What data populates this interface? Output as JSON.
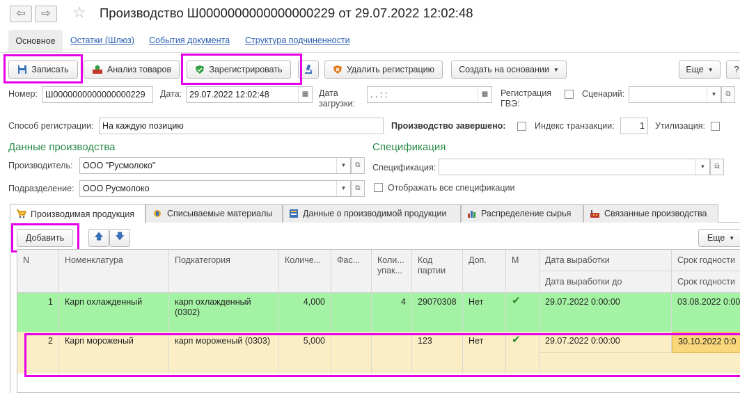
{
  "window": {
    "title": "Производство Ш0000000000000000229 от 29.07.2022 12:02:48",
    "back_icon": "arrow-left-icon",
    "forward_icon": "arrow-right-icon",
    "favorite_icon": "star-icon"
  },
  "tabs": [
    {
      "label": "Основное"
    },
    {
      "label": "Остатки (Шлюз)"
    },
    {
      "label": "События документа"
    },
    {
      "label": "Структура подчиненности"
    }
  ],
  "toolbar": {
    "save_label": "Записать",
    "analyze_label": "Анализ товаров",
    "register_label": "Зарегистрировать",
    "delete_reg_label": "Удалить регистрацию",
    "create_based_label": "Создать на основании",
    "more_label": "Еще",
    "help_label": "?"
  },
  "header": {
    "number_label": "Номер:",
    "number_value": "Ш0000000000000000229",
    "date_label": "Дата:",
    "date_value": "29.07.2022 12:02:48",
    "load_date_label": "Дата загрузки:",
    "load_date_value": " .   .        :   :",
    "gve_label": "Регистрация ГВЭ:",
    "scenario_label": "Сценарий:",
    "scenario_value": "",
    "method_label": "Способ регистрации:",
    "method_value": "На каждую позицию",
    "completed_label": "Производство завершено:",
    "transaction_label": "Индекс транзакции:",
    "transaction_value": "1",
    "utilization_label": "Утилизация:"
  },
  "production": {
    "section_title": "Данные производства",
    "producer_label": "Производитель:",
    "producer_value": "ООО \"Русмолоко\"",
    "division_label": "Подразделение:",
    "division_value": "ООО Русмолоко"
  },
  "specification": {
    "section_title": "Спецификация",
    "spec_label": "Спецификация:",
    "spec_value": "",
    "show_all_label": "Отображать все спецификации"
  },
  "page_tabs": [
    {
      "label": "Производимая продукция"
    },
    {
      "label": "Списываемые материалы"
    },
    {
      "label": "Данные о производимой продукции"
    },
    {
      "label": "Распределение сырья"
    },
    {
      "label": "Связанные производства"
    }
  ],
  "table_toolbar": {
    "add_label": "Добавить",
    "more_label": "Еще"
  },
  "table": {
    "headers": {
      "n": "N",
      "nomenclature": "Номенклатура",
      "subcategory": "Подкатегория",
      "quantity": "Количе...",
      "packing": "Фас...",
      "pack_qty": "Коли... упак...",
      "batch": "Код партии",
      "extra": "Доп.",
      "m": "М",
      "prod_date": "Дата выработки",
      "prod_date_to": "Дата выработки до",
      "expiry": "Срок годности",
      "expiry_to": "Срок годности"
    },
    "rows": [
      {
        "n": "1",
        "nomenclature": "Карп охлажденный",
        "subcategory": "карп охлажденный (0302)",
        "quantity": "4,000",
        "packing": "",
        "pack_qty": "4",
        "batch": "29070308",
        "extra": "Нет",
        "m": "✔",
        "prod_date": "29.07.2022 0:00:00",
        "expiry": "03.08.2022 0:00"
      },
      {
        "n": "2",
        "nomenclature": "Карп мороженый",
        "subcategory": "карп мороженый (0303)",
        "quantity": "5,000",
        "packing": "",
        "pack_qty": "",
        "batch": "123",
        "extra": "Нет",
        "m": "✔",
        "prod_date": "29.07.2022 0:00:00",
        "expiry": "30.10.2022 0:0"
      }
    ]
  },
  "colors": {
    "row_green": "#a4f3a4",
    "row_selected": "#fbeec4",
    "highlight": "#e600e6",
    "section_green": "#2a8a4a",
    "link_blue": "#2a5db0"
  }
}
